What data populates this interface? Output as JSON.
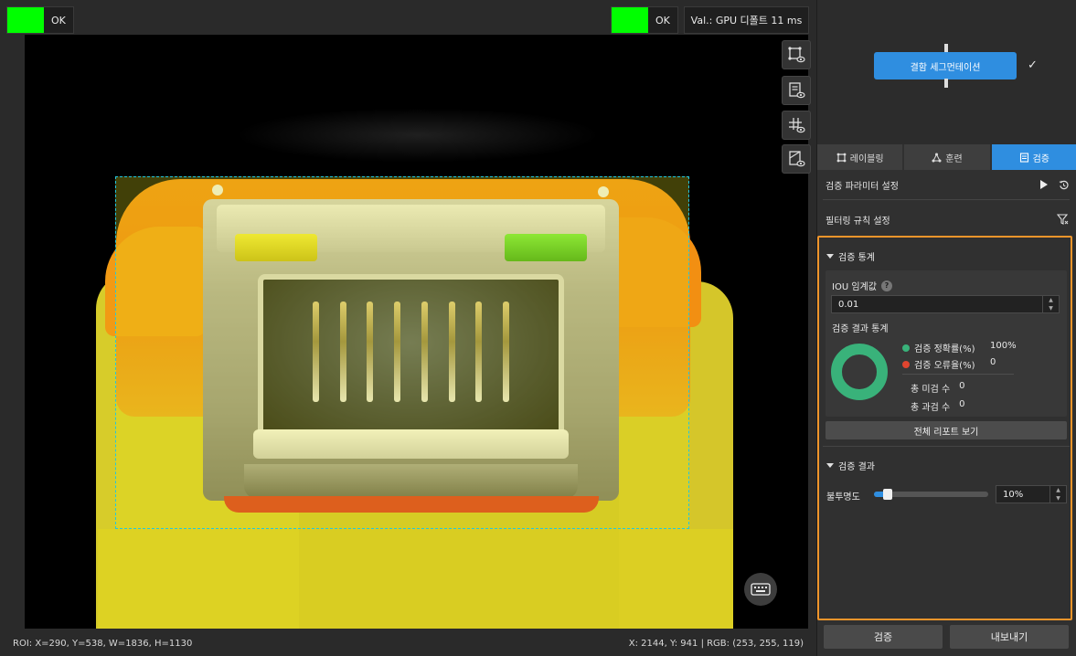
{
  "viewer": {
    "left_status": {
      "label": "OK",
      "color": "#00ff00"
    },
    "right_status": {
      "label": "OK",
      "color": "#00ff00"
    },
    "val_text": "Val.: GPU 디폴트 11 ms",
    "toolbar_icons": [
      "roi-view-icon",
      "result-view-icon",
      "grid-view-icon",
      "mask-view-icon"
    ],
    "roi_text": "ROI: X=290, Y=538, W=1836, H=1130",
    "cursor_text": "X: 2144, Y: 941 | RGB: (253, 255, 119)",
    "keyboard_icon": "keyboard-icon"
  },
  "flow": {
    "node_label": "결함 세그먼테이션",
    "check_icon": "✓"
  },
  "tabs": [
    {
      "label": "레이블링",
      "icon": "labeling-icon"
    },
    {
      "label": "훈련",
      "icon": "training-icon"
    },
    {
      "label": "검증",
      "icon": "validation-icon",
      "active": true
    }
  ],
  "panel": {
    "param_settings": "검증 파라미터 설정",
    "filter_settings": "필터링 규칙 설정",
    "stats_section": "검증 통계",
    "iou_label": "IOU 임계값",
    "iou_help": "?",
    "iou_value": "0.01",
    "result_stats_label": "검증 결과 통계",
    "accuracy_label": "검증 정확률(%)",
    "accuracy_value": "100%",
    "error_label": "검증 오류율(%)",
    "error_value": "0",
    "missed_label": "총 미검 수",
    "missed_value": "0",
    "over_label": "총 과검 수",
    "over_value": "0",
    "report_button": "전체 리포트 보기",
    "results_section": "검증 결과",
    "opacity_label": "불투명도",
    "opacity_value": "10%",
    "opacity_level": 0.1,
    "accuracy_color": "#39b27a",
    "error_color": "#e0452f",
    "highlight_color": "#f0952b",
    "accent_color": "#2f8ee0"
  },
  "bottom": {
    "validate_button": "검증",
    "export_button": "내보내기"
  }
}
